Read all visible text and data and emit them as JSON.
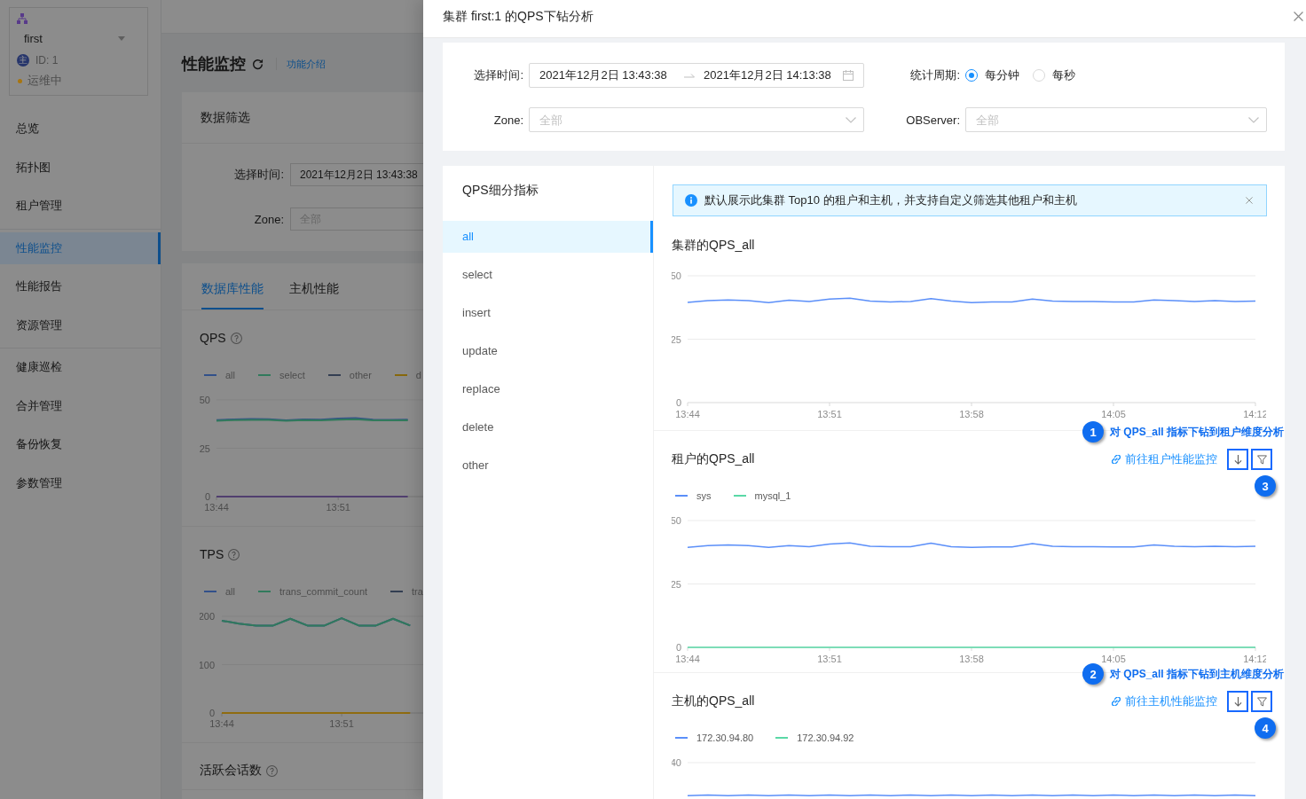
{
  "background_page": {
    "sidebar": {
      "cluster": {
        "name": "first",
        "role_badge": "主",
        "id": "ID: 1",
        "status": {
          "label": "运维中",
          "color": "#a8750f"
        }
      },
      "menu_groups": [
        {
          "items": [
            {
              "label": "总览",
              "selected": false
            },
            {
              "label": "拓扑图",
              "selected": false
            },
            {
              "label": "租户管理",
              "selected": false
            }
          ]
        },
        {
          "items": [
            {
              "label": "性能监控",
              "selected": true
            },
            {
              "label": "性能报告",
              "selected": false
            },
            {
              "label": "资源管理",
              "selected": false
            }
          ]
        },
        {
          "items": [
            {
              "label": "健康巡检",
              "selected": false
            },
            {
              "label": "合并管理",
              "selected": false
            },
            {
              "label": "备份恢复",
              "selected": false
            },
            {
              "label": "参数管理",
              "selected": false
            }
          ]
        }
      ]
    },
    "page_title": "性能监控",
    "intro_link": "功能介绍",
    "filter": {
      "title": "数据筛选",
      "fields": [
        {
          "label": "选择时间:",
          "value": "2021年12月2日 13:43:38"
        },
        {
          "label": "Zone:",
          "placeholder": "全部"
        }
      ]
    },
    "tabs": [
      {
        "label": "数据库性能",
        "selected": true
      },
      {
        "label": "主机性能",
        "selected": false
      }
    ],
    "panels": [
      {
        "title": "QPS",
        "chart_data": {
          "type": "line",
          "legend": "top",
          "categories": [
            "13:44",
            null,
            null,
            null,
            null,
            null,
            null,
            "13:51",
            null,
            null,
            null,
            null
          ],
          "ylim": [
            0,
            50
          ],
          "yticks": [
            0,
            25,
            50
          ],
          "series": [
            {
              "name": "all",
              "color": "#32508a",
              "values": [
                39.6,
                39.9,
                40.1,
                40.0,
                39.5,
                39.9,
                39.8,
                40.3,
                40.6,
                39.8,
                39.7,
                39.8
              ]
            },
            {
              "name": "select",
              "color": "#317a5c",
              "values": [
                39.2,
                39.6,
                39.7,
                39.7,
                39.2,
                39.6,
                39.5,
                39.8,
                40.0,
                39.4,
                39.4,
                39.5
              ]
            },
            {
              "name": "other",
              "color": "#333e52",
              "values": [
                null,
                null,
                null,
                null,
                null,
                null,
                null,
                null,
                null,
                null,
                null,
                null
              ]
            },
            {
              "name": "d",
              "color": "#87680c",
              "values": [
                null,
                null,
                null,
                null,
                null,
                null,
                null,
                null,
                null,
                null,
                null,
                null
              ]
            },
            {
              "color": "#503e6f",
              "values": [
                0,
                0,
                0,
                0,
                0,
                0,
                0,
                0,
                0,
                0,
                0,
                0
              ]
            }
          ]
        }
      },
      {
        "title": "TPS",
        "chart_data": {
          "type": "line",
          "legend": "top",
          "categories": [
            "13:44",
            null,
            null,
            null,
            null,
            null,
            null,
            "13:51",
            null,
            null,
            null,
            null
          ],
          "ylim": [
            0,
            200
          ],
          "yticks": [
            0,
            100,
            200
          ],
          "series": [
            {
              "name": "all",
              "color": "#32508a",
              "values": [
                191,
                185,
                181,
                181,
                195,
                181,
                181,
                196,
                181,
                181,
                195,
                181
              ]
            },
            {
              "name": "trans_commit_count",
              "color": "#317a5c",
              "values": [
                191,
                185,
                181,
                181,
                195,
                181,
                181,
                196,
                181,
                181,
                195,
                181
              ]
            },
            {
              "name": "tra",
              "color": "#333e52",
              "values": [
                null,
                null,
                null,
                null,
                null,
                null,
                null,
                null,
                null,
                null,
                null,
                null
              ]
            },
            {
              "color": "#8f6c10",
              "values": [
                0,
                0,
                0,
                0,
                0,
                0,
                0,
                0,
                0,
                0,
                0,
                0
              ]
            }
          ]
        }
      },
      {
        "title": "活跃会话数"
      }
    ]
  },
  "drawer": {
    "title": "集群 first:1 的QPS下钻分析",
    "filters": {
      "time": {
        "label": "选择时间:",
        "start": "2021年12月2日 13:43:38",
        "end": "2021年12月2日 14:13:38"
      },
      "period": {
        "label": "统计周期:",
        "options": [
          {
            "label": "每分钟",
            "selected": true
          },
          {
            "label": "每秒",
            "selected": false
          }
        ]
      },
      "zone": {
        "label": "Zone:",
        "placeholder": "全部"
      },
      "server": {
        "label": "OBServer:",
        "placeholder": "全部"
      }
    },
    "metrics": {
      "title": "QPS细分指标",
      "items": [
        {
          "label": "all",
          "selected": true
        },
        {
          "label": "select",
          "selected": false
        },
        {
          "label": "insert",
          "selected": false
        },
        {
          "label": "update",
          "selected": false
        },
        {
          "label": "replace",
          "selected": false
        },
        {
          "label": "delete",
          "selected": false
        },
        {
          "label": "other",
          "selected": false
        }
      ]
    },
    "alert": "默认展示此集群 Top10 的租户和主机，并支持自定义筛选其他租户和主机",
    "sections": [
      {
        "title": "集群的QPS_all",
        "chart_data": {
          "type": "line",
          "categories": [
            "13:44",
            null,
            null,
            null,
            null,
            null,
            null,
            "13:51",
            null,
            null,
            null,
            null,
            null,
            null,
            "13:58",
            null,
            null,
            null,
            null,
            null,
            null,
            "14:05",
            null,
            null,
            null,
            null,
            null,
            null,
            "14:12"
          ],
          "ylim": [
            0,
            50
          ],
          "yticks": [
            0,
            25,
            50
          ],
          "series": [
            {
              "color": "#5b8ff9",
              "values": [
                39.5,
                40.2,
                40.5,
                40.2,
                39.4,
                40.4,
                39.9,
                40.8,
                41.2,
                40.0,
                39.7,
                39.9,
                41.0,
                40.0,
                39.4,
                39.7,
                39.7,
                40.8,
                40.0,
                39.9,
                39.9,
                39.7,
                39.7,
                40.5,
                40.2,
                39.9,
                40.2,
                39.9,
                40.0
              ]
            }
          ]
        }
      },
      {
        "title": "租户的QPS_all",
        "link": "前往租户性能监控",
        "buttons": [
          {
            "kind": "drill",
            "highlighted": true
          },
          {
            "kind": "filter",
            "highlighted": true
          }
        ],
        "callout": {
          "number": "1",
          "text": "对 QPS_all 指标下钻到租户维度分析"
        },
        "buttons_callout": "3",
        "chart_data": {
          "type": "line",
          "legend": "top",
          "categories": [
            "13:44",
            null,
            null,
            null,
            null,
            null,
            null,
            "13:51",
            null,
            null,
            null,
            null,
            null,
            null,
            "13:58",
            null,
            null,
            null,
            null,
            null,
            null,
            "14:05",
            null,
            null,
            null,
            null,
            null,
            null,
            "14:12"
          ],
          "ylim": [
            0,
            50
          ],
          "yticks": [
            0,
            25,
            50
          ],
          "series": [
            {
              "name": "sys",
              "color": "#5b8ff9",
              "values": [
                39.4,
                40.1,
                40.4,
                40.1,
                39.4,
                40.1,
                39.7,
                40.7,
                41.2,
                39.9,
                39.7,
                39.7,
                41.1,
                39.7,
                39.4,
                39.6,
                39.6,
                40.9,
                39.9,
                39.7,
                39.7,
                39.6,
                39.6,
                40.4,
                39.9,
                39.7,
                39.9,
                39.7,
                39.9
              ]
            },
            {
              "name": "mysql_1",
              "color": "#5ad8a6",
              "values": [
                0,
                0,
                0,
                0,
                0,
                0,
                0,
                0,
                0,
                0,
                0,
                0,
                0,
                0,
                0,
                0,
                0,
                0,
                0,
                0,
                0,
                0,
                0,
                0,
                0,
                0,
                0,
                0,
                0
              ]
            }
          ]
        }
      },
      {
        "title": "主机的QPS_all",
        "link": "前往主机性能监控",
        "buttons": [
          {
            "kind": "drill",
            "highlighted": true
          },
          {
            "kind": "filter",
            "highlighted": true
          }
        ],
        "callout": {
          "number": "2",
          "text": "对 QPS_all 指标下钻到主机维度分析"
        },
        "buttons_callout": "4",
        "legend": [
          {
            "name": "172.30.94.80",
            "color": "#5b8ff9"
          },
          {
            "name": "172.30.94.92",
            "color": "#5ad8a6"
          }
        ],
        "axis_label": "40"
      }
    ]
  }
}
